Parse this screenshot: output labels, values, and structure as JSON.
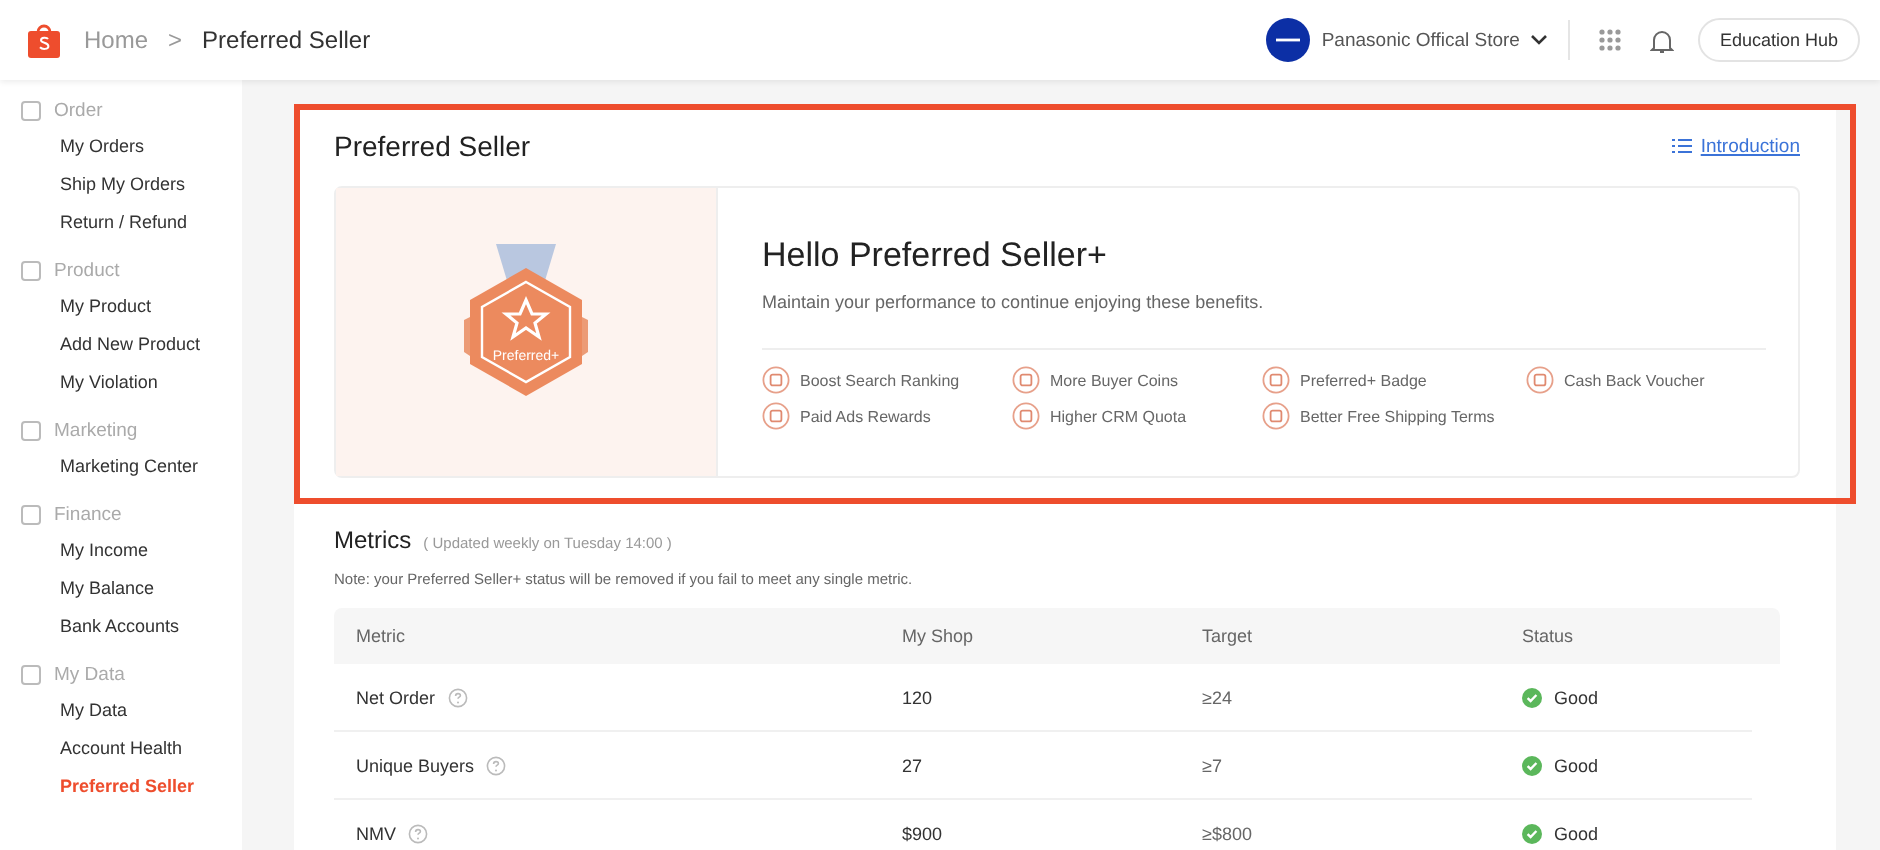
{
  "breadcrumb": {
    "home": "Home",
    "separator": ">",
    "current": "Preferred Seller"
  },
  "header": {
    "store": "Panasonic Offical Store",
    "education_button": "Education Hub"
  },
  "sidebar": {
    "groups": [
      {
        "title": "Order",
        "items": [
          {
            "label": "My Orders",
            "selected": false
          },
          {
            "label": "Ship My Orders",
            "selected": false
          },
          {
            "label": "Return / Refund",
            "selected": false
          }
        ]
      },
      {
        "title": "Product",
        "items": [
          {
            "label": "My Product",
            "selected": false
          },
          {
            "label": "Add New Product",
            "selected": false
          },
          {
            "label": "My Violation",
            "selected": false
          }
        ]
      },
      {
        "title": "Marketing",
        "items": [
          {
            "label": "Marketing Center",
            "selected": false
          }
        ]
      },
      {
        "title": "Finance",
        "items": [
          {
            "label": "My Income",
            "selected": false
          },
          {
            "label": "My Balance",
            "selected": false
          },
          {
            "label": "Bank Accounts",
            "selected": false
          }
        ]
      },
      {
        "title": "My Data",
        "items": [
          {
            "label": "My Data",
            "selected": false
          },
          {
            "label": "Account Health",
            "selected": false
          },
          {
            "label": "Preferred Seller",
            "selected": true
          }
        ]
      }
    ]
  },
  "preferred": {
    "title": "Preferred Seller",
    "intro_link": "Introduction",
    "badge_label": "Preferred+",
    "heading": "Hello Preferred Seller+",
    "subtitle": "Maintain your performance to continue enjoying these benefits.",
    "benefits": [
      "Boost Search Ranking",
      "More Buyer Coins",
      "Preferred+ Badge",
      "Cash Back Voucher",
      "Paid Ads Rewards",
      "Higher CRM Quota",
      "Better Free Shipping Terms"
    ]
  },
  "metrics": {
    "title": "Metrics",
    "updated": "( Updated weekly on Tuesday 14:00 )",
    "note": "Note: your Preferred Seller+ status will be removed if you fail to meet any single metric.",
    "columns": [
      "Metric",
      "My Shop",
      "Target",
      "Status"
    ],
    "rows": [
      {
        "metric": "Net Order",
        "my_shop": "120",
        "target": "≥24",
        "status": "Good",
        "kind": "good"
      },
      {
        "metric": "Unique Buyers",
        "my_shop": "27",
        "target": "≥7",
        "status": "Good",
        "kind": "good"
      },
      {
        "metric": "NMV",
        "my_shop": "$900",
        "target": "≥$800",
        "status": "Good",
        "kind": "good"
      }
    ]
  }
}
